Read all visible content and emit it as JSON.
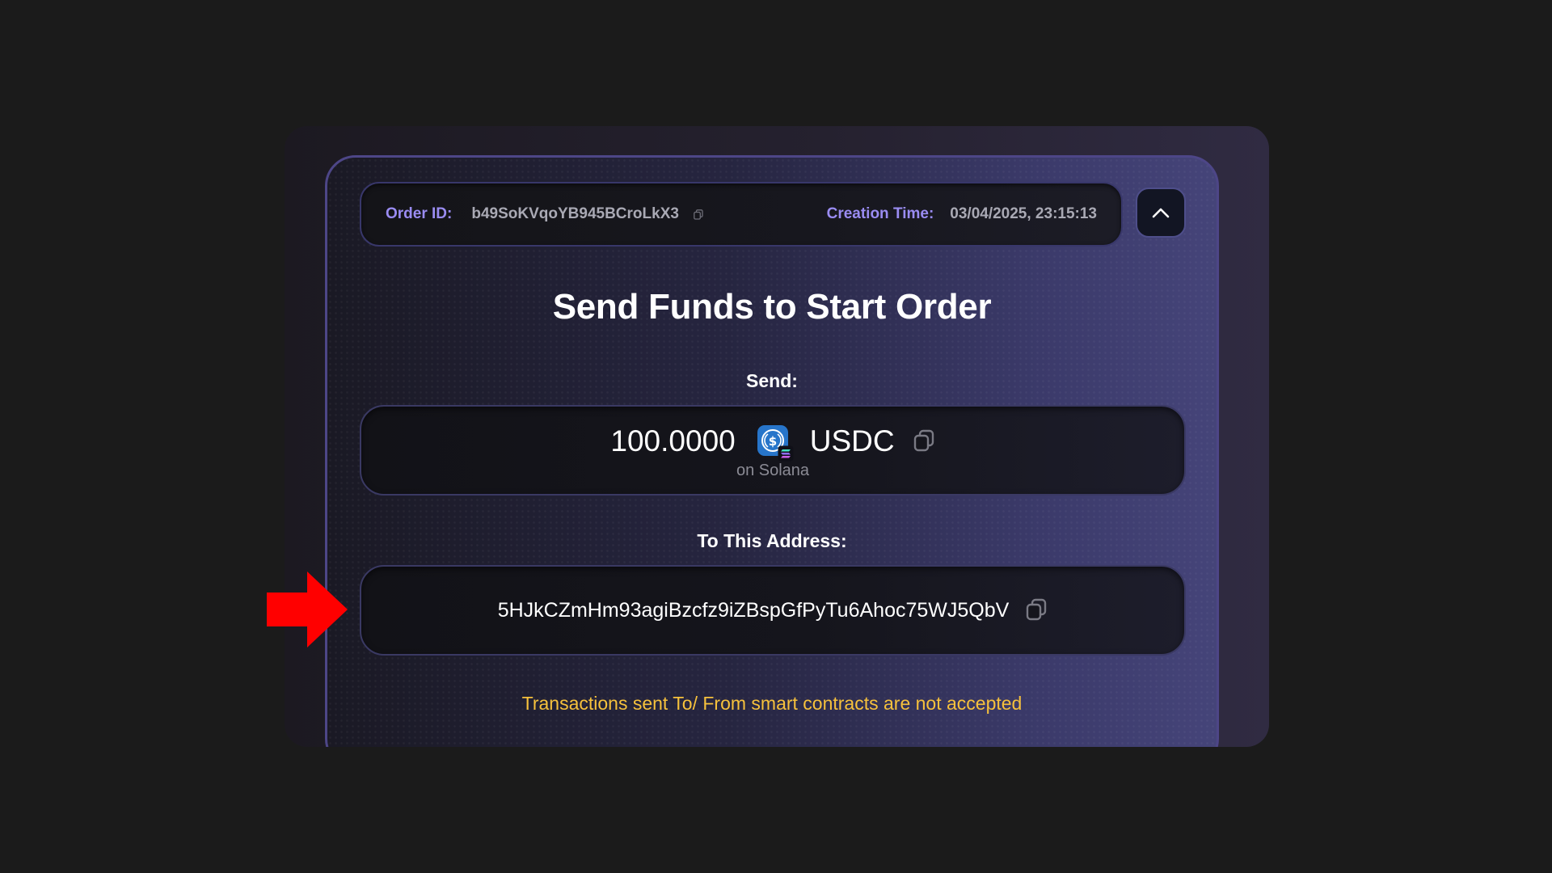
{
  "header": {
    "order_id_label": "Order ID:",
    "order_id_value": "b49SoKVqoYB945BCroLkX3",
    "creation_time_label": "Creation Time:",
    "creation_time_value": "03/04/2025, 23:15:13",
    "collapse_icon": "chevron-up-icon",
    "copy_icon": "copy-icon"
  },
  "title": "Send Funds to Start Order",
  "send": {
    "label": "Send:",
    "amount": "100.0000",
    "token": "USDC",
    "token_icon": "usdc-icon",
    "chain_badge_icon": "solana-icon",
    "chain_note": "on Solana"
  },
  "address": {
    "label": "To This Address:",
    "value": "5HJkCZmHm93agiBzcfz9iZBspGfPyTu6Ahoc75WJ5QbV"
  },
  "warning": "Transactions sent To/ From smart contracts are not accepted",
  "colors": {
    "accent_label": "#9a8cf2",
    "warning": "#f6c13c",
    "annotation_arrow": "#ff0000",
    "usdc_blue": "#2775ca"
  }
}
